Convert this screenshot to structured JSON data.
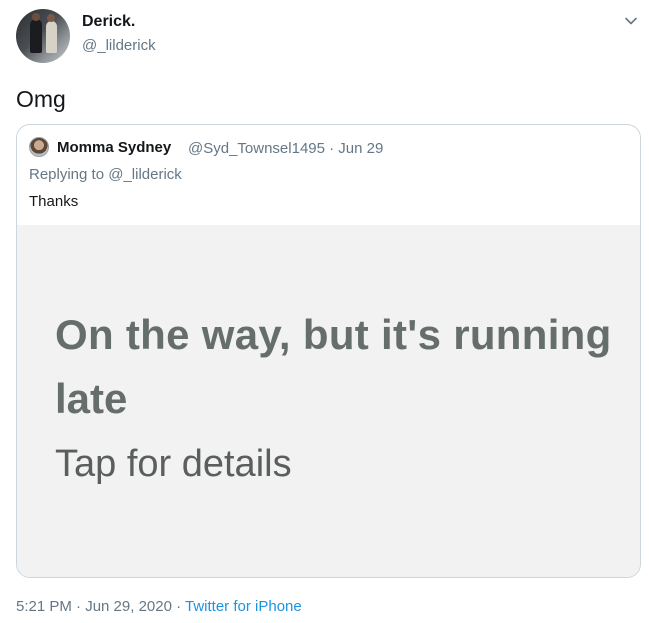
{
  "tweet": {
    "author": {
      "display_name": "Derick.",
      "handle": "@_lilderick"
    },
    "text": "Omg",
    "timestamp": "5:21 PM · Jun 29, 2020",
    "separator": " · ",
    "source": "Twitter for iPhone"
  },
  "quoted_tweet": {
    "display_name": "Momma Sydney",
    "meta": "@Syd_Townsel1495 · Jun 29",
    "replying_prefix": "Replying to ",
    "replying_to": "@_lilderick",
    "text": "Thanks",
    "media": {
      "line1": "On the way, but it's running",
      "line2": "late",
      "line3": "Tap for details"
    }
  },
  "colors": {
    "link": "#1b95e0",
    "muted": "#657786",
    "border": "#ccd6dd"
  },
  "icons": {
    "more": "chevron-down-icon"
  }
}
